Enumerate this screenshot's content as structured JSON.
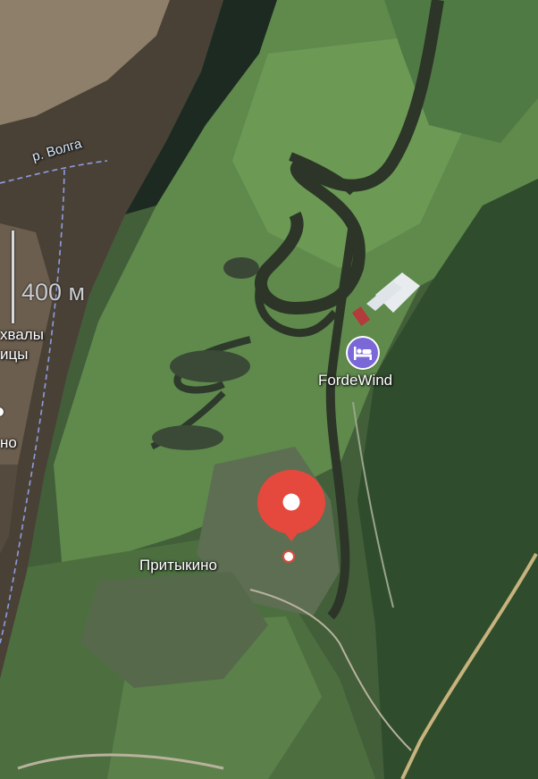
{
  "map": {
    "river_label": "р. Волга",
    "scale_text": "400 м",
    "partial_label_top": "хвалы\nицы",
    "partial_label_bottom": "но",
    "poi": {
      "label": "FordeWind",
      "icon": "hotel-bed-icon",
      "color": "#7b68d8"
    },
    "village_label": "Притыкино",
    "pin_color": "#e5483d"
  }
}
